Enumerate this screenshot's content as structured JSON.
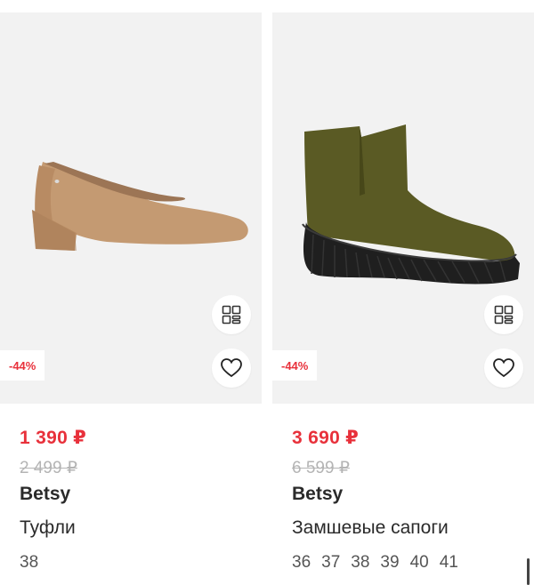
{
  "products": [
    {
      "discount": "-44%",
      "price": "1 390 ₽",
      "old_price": "2 499 ₽",
      "brand": "Betsy",
      "title": "Туфли",
      "sizes": [
        "38"
      ],
      "image": "tan-suede-pump",
      "icons": {
        "similar": "grid-similar-icon",
        "favorite": "heart-icon"
      }
    },
    {
      "discount": "-44%",
      "price": "3 690 ₽",
      "old_price": "6 599 ₽",
      "brand": "Betsy",
      "title": "Замшевые сапоги",
      "sizes": [
        "36",
        "37",
        "38",
        "39",
        "40",
        "41"
      ],
      "image": "olive-suede-ankle-boot",
      "icons": {
        "similar": "grid-similar-icon",
        "favorite": "heart-icon"
      }
    }
  ],
  "colors": {
    "accent": "#e8313b",
    "old_price": "#b4b4b4",
    "image_bg": "#f2f2f2"
  }
}
